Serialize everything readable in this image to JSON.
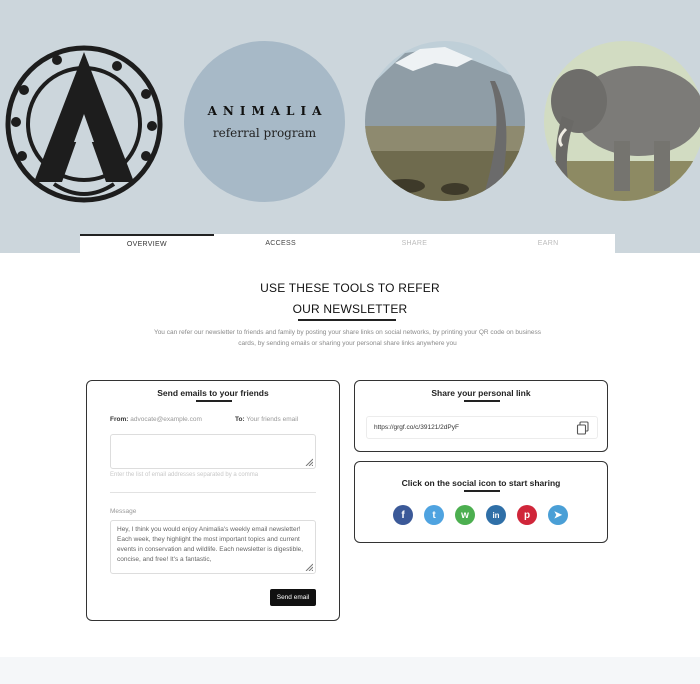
{
  "hero": {
    "brand_name": "ANIMALIA",
    "brand_subtitle": "referral program",
    "bg_color": "#ccd6dc",
    "circle_color": "#a7b9c7"
  },
  "tabs": [
    {
      "label": "OVERVIEW",
      "active": true
    },
    {
      "label": "ACCESS",
      "active": false
    },
    {
      "label": "SHARE",
      "active": false
    },
    {
      "label": "EARN",
      "active": false
    }
  ],
  "main": {
    "title_line1": "USE THESE TOOLS TO REFER",
    "title_line2": "OUR NEWSLETTER",
    "intro": "You can refer our newsletter to friends and family by posting your share links on social networks, by printing your QR code on business cards, by sending emails or sharing your personal share links anywhere you"
  },
  "email_card": {
    "title": "Send emails to your friends",
    "from_label": "From:",
    "from_value": "advocate@example.com",
    "to_label": "To:",
    "to_placeholder": "Your friends email",
    "recipients_hint": "Enter the list of email addresses separated by a comma",
    "message_label": "Message",
    "message_body": "Hey, I think you would enjoy Animalia's weekly email newsletter! Each week, they highlight the most important topics and current events in conservation and wildlife. Each newsletter is digestible, concise, and free! It's a fantastic,",
    "send_label": "Send email"
  },
  "link_card": {
    "title": "Share your personal link",
    "link": "https://grgf.co/c/39121/2dPyF"
  },
  "social_card": {
    "title": "Click on the social icon to start sharing",
    "icons": [
      {
        "name": "facebook-icon",
        "color": "#3b5998",
        "glyph": "f"
      },
      {
        "name": "twitter-icon",
        "color": "#4fa3e0",
        "glyph": "t"
      },
      {
        "name": "whatsapp-icon",
        "color": "#4caf50",
        "glyph": "w"
      },
      {
        "name": "linkedin-icon",
        "color": "#2f6fa7",
        "glyph": "in"
      },
      {
        "name": "pinterest-icon",
        "color": "#d0263a",
        "glyph": "p"
      },
      {
        "name": "telegram-icon",
        "color": "#4a9fd6",
        "glyph": "➤"
      }
    ]
  }
}
